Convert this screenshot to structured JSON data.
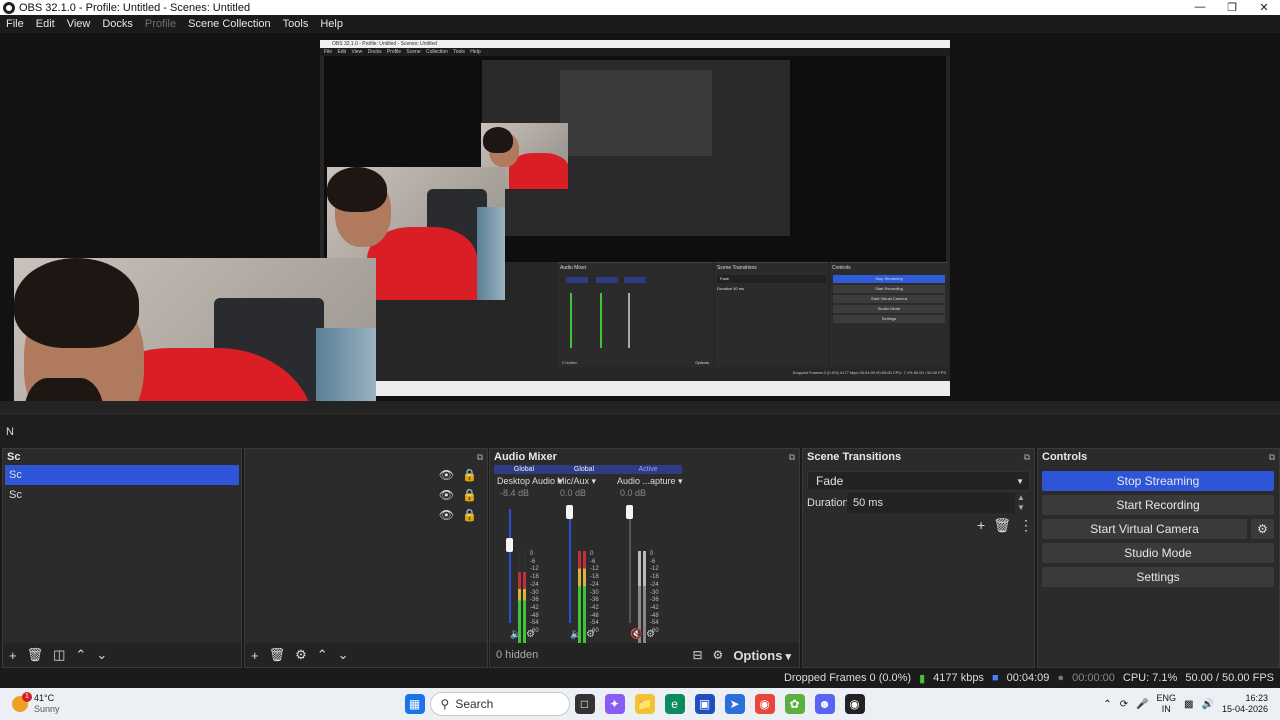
{
  "window": {
    "title": "OBS 32.1.0 - Profile: Untitled - Scenes: Untitled"
  },
  "menu": [
    "File",
    "Edit",
    "View",
    "Docks",
    "Profile",
    "Scene Collection",
    "Tools",
    "Help"
  ],
  "mini": {
    "title": "OBS 32.1.0 - Profile: Untitled - Scenes: Untitled",
    "menu": "File Edit View Docks Profile Scene Collection Tools Help",
    "audio_title": "Audio Mixer",
    "transitions_title": "Scene Transitions",
    "fade": "Fade",
    "duration": "Duration",
    "ms": "50 ms",
    "controls_title": "Controls",
    "stop": "Stop Streaming",
    "rec": "Start Recording",
    "vcam": "Start Virtual Camera",
    "studio": "Studio Mode",
    "settings": "Settings",
    "status": "Dropped Frames 0 (0.0%)  4177 kbps  00:04:09  00:00:00  CPU: 7.1%  50.00 / 50.00 FPS",
    "hidden": "0 hidden",
    "options": "Options"
  },
  "docks": {
    "scenes_label": "Sc",
    "scene_item": "Sc",
    "scene_item2": "Sc",
    "n_label": "N"
  },
  "audio": {
    "title": "Audio Mixer",
    "channels": [
      {
        "tag": "Global",
        "name": "Desktop Audio",
        "db": "-8.4 dB",
        "fader": 0.6
      },
      {
        "tag": "Global",
        "name": "Mic/Aux",
        "db": "0.0 dB",
        "fader": 1.0
      },
      {
        "tag": "Active",
        "name": "Audio ...apture",
        "db": "0.0 dB",
        "fader": 1.0
      }
    ],
    "scale": [
      "0",
      "-6",
      "-12",
      "-18",
      "-24",
      "-30",
      "-36",
      "-42",
      "-48",
      "-54",
      "-60"
    ],
    "hidden": "0 hidden",
    "options": "Options"
  },
  "transitions": {
    "title": "Scene Transitions",
    "selected": "Fade",
    "duration_label": "Duration",
    "duration_value": "50 ms"
  },
  "controls": {
    "title": "Controls",
    "stop_streaming": "Stop Streaming",
    "start_recording": "Start Recording",
    "start_virtual_camera": "Start Virtual Camera",
    "studio_mode": "Studio Mode",
    "settings": "Settings"
  },
  "status": {
    "dropped": "Dropped Frames 0 (0.0%)",
    "kbps": "4177 kbps",
    "stream_time": "00:04:09",
    "rec_time": "00:00:00",
    "cpu": "CPU: 7.1%",
    "fps": "50.00 / 50.00 FPS"
  },
  "taskbar": {
    "weather_temp": "41°C",
    "weather_desc": "Sunny",
    "weather_badge": "1",
    "search": "Search",
    "lang": "ENG",
    "region": "IN",
    "time": "16:23",
    "date": "15-04-2026"
  },
  "colors": {
    "accent": "#2e55d8",
    "meter_green": "#3ec33a",
    "meter_yellow": "#d5b53a",
    "meter_red": "#c0303a"
  }
}
